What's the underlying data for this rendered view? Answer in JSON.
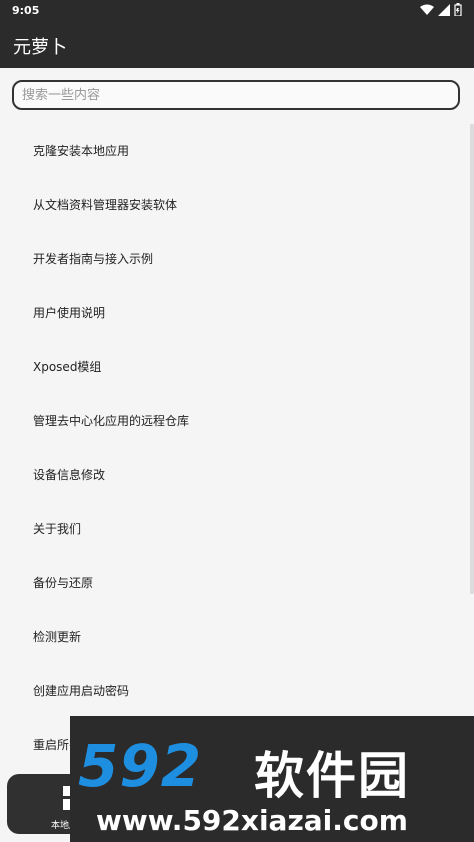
{
  "status_bar": {
    "time": "9:05"
  },
  "app": {
    "title": "元萝卜"
  },
  "search": {
    "placeholder": "搜索一些内容",
    "value": ""
  },
  "menu_items": [
    "克隆安装本地应用",
    "从文档资料管理器安装软体",
    "开发者指南与接入示例",
    "用户使用说明",
    "Xposed模组",
    "管理去中心化应用的远程仓库",
    "设备信息修改",
    "关于我们",
    "备份与还原",
    "检测更新",
    "创建应用启动密码",
    "重启所有"
  ],
  "bottom_nav": {
    "label": "本地应"
  },
  "watermark": {
    "logo_num": "592",
    "logo_text": "软件园",
    "url": "www.592xiazai.com"
  }
}
